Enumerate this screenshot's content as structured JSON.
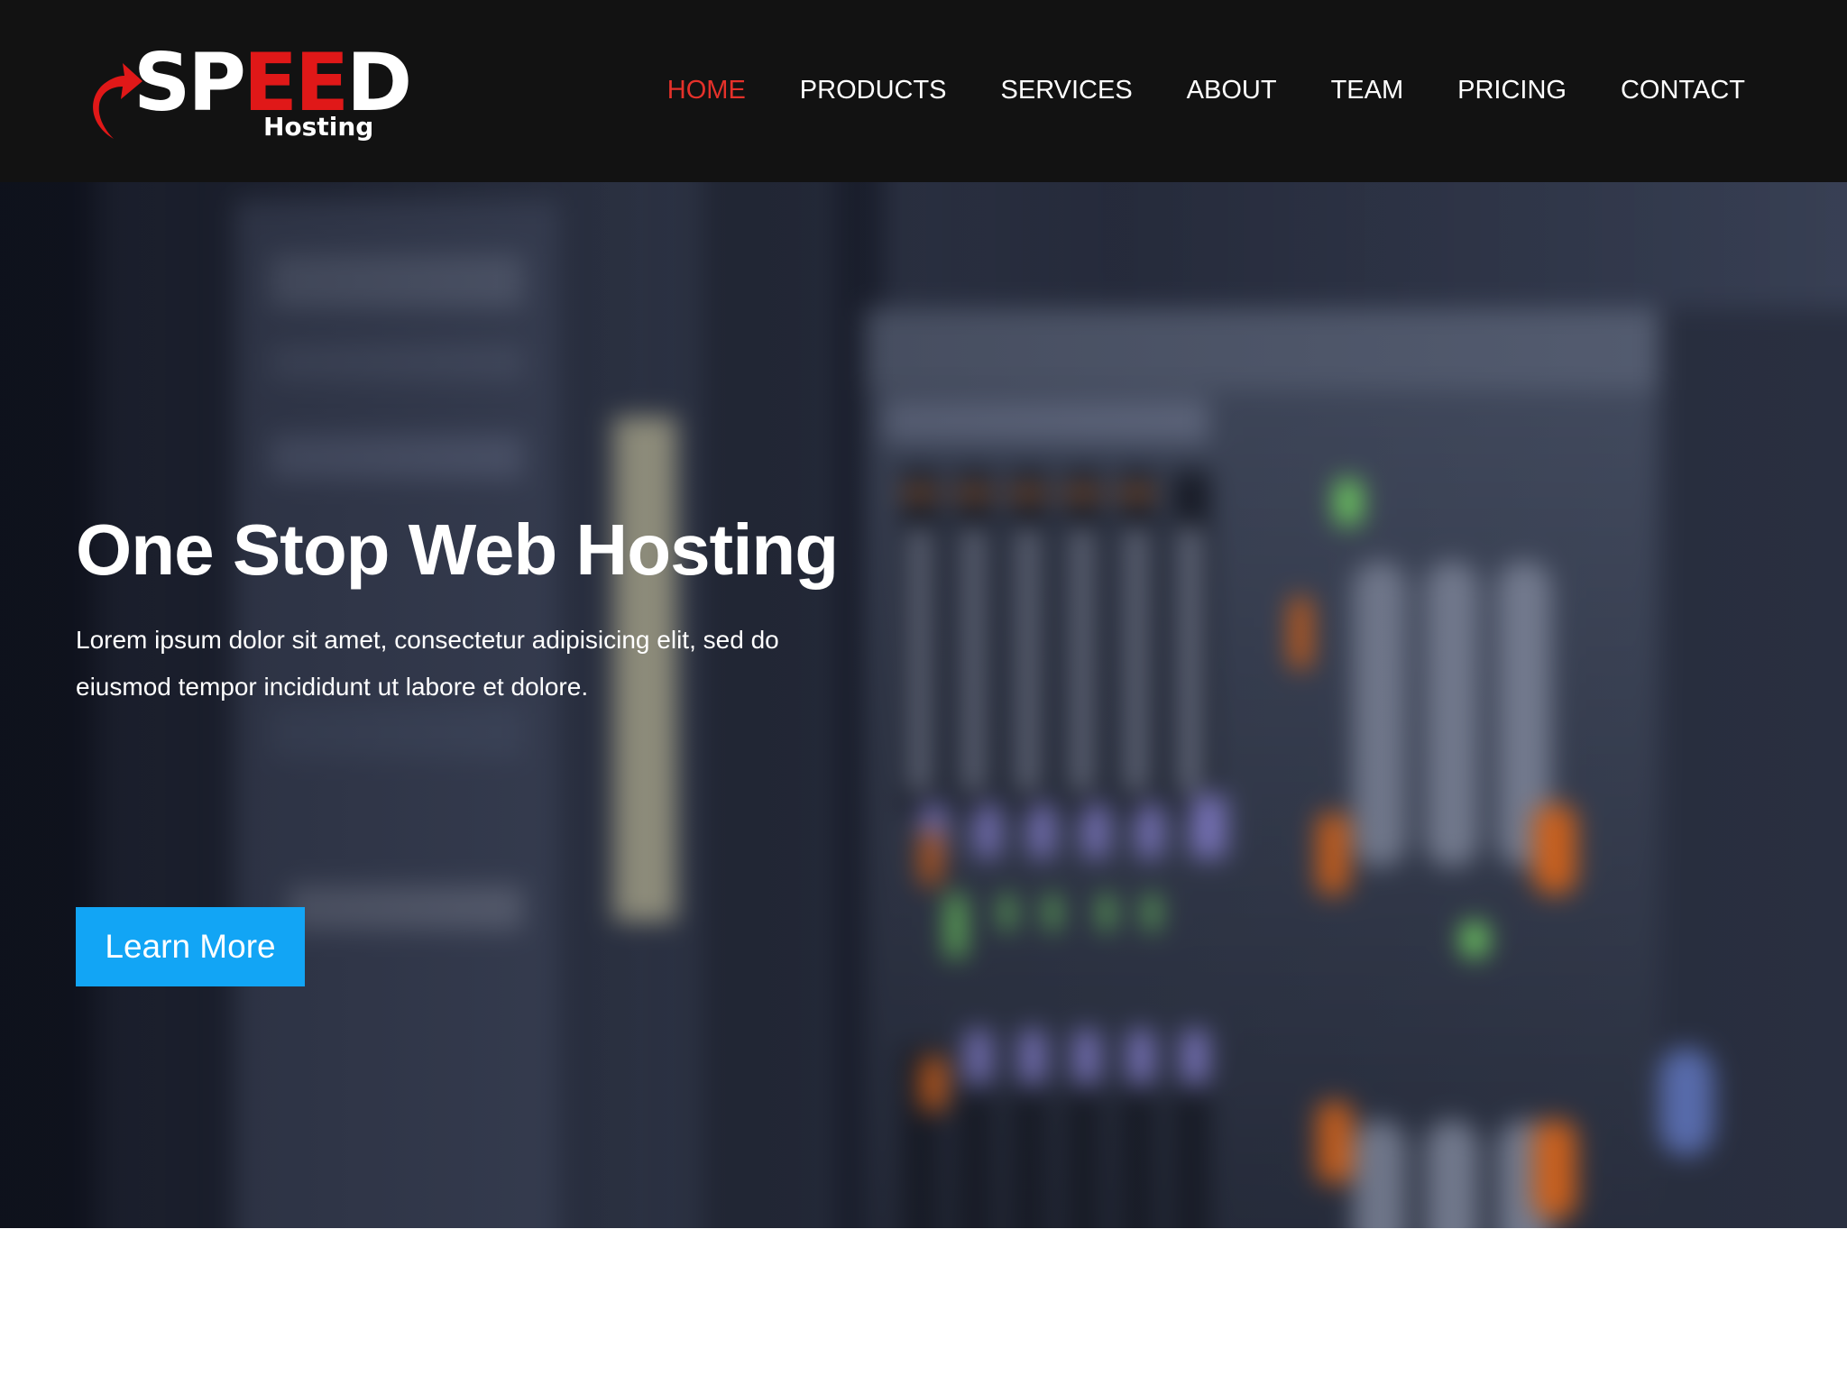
{
  "brand": {
    "logo_prefix": "SP",
    "logo_accent": "EE",
    "logo_suffix": "D",
    "logo_sub": "Hosting",
    "colors": {
      "header_bg": "#121212",
      "accent_red": "#e5312a",
      "button_blue": "#12a5f5"
    }
  },
  "nav": {
    "items": [
      {
        "label": "HOME",
        "active": true
      },
      {
        "label": "PRODUCTS",
        "active": false
      },
      {
        "label": "SERVICES",
        "active": false
      },
      {
        "label": "ABOUT",
        "active": false
      },
      {
        "label": "TEAM",
        "active": false
      },
      {
        "label": "PRICING",
        "active": false
      },
      {
        "label": "CONTACT",
        "active": false
      }
    ]
  },
  "hero": {
    "title": "One Stop Web Hosting",
    "text": "Lorem ipsum dolor sit amet, consectetur adipisicing elit, sed do eiusmod tempor incididunt ut labore et dolore.",
    "button_label": "Learn More",
    "background": "blurred-server-rack-photo"
  }
}
